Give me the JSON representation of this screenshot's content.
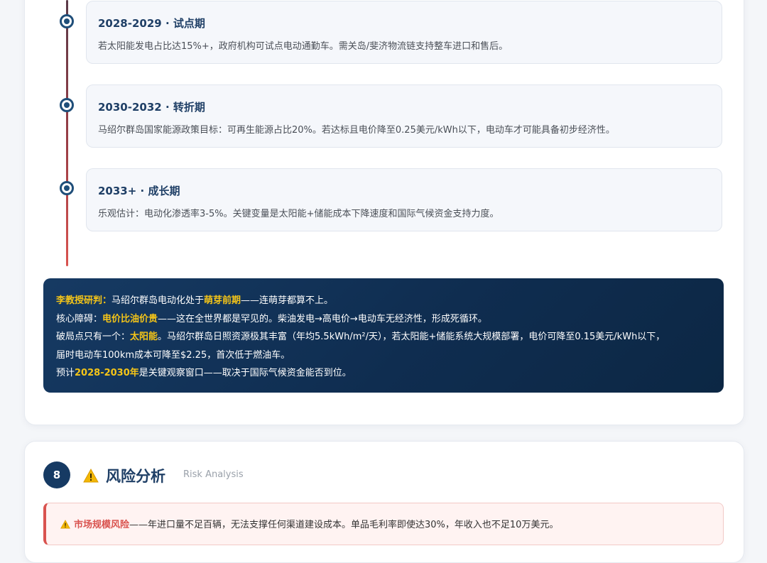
{
  "timeline": [
    {
      "title": "2028-2029 · 试点期",
      "desc": "若太阳能发电占比达15%+，政府机构可试点电动通勤车。需关岛/斐济物流链支持整车进口和售后。"
    },
    {
      "title": "2030-2032 · 转折期",
      "desc": "马绍尔群岛国家能源政策目标：可再生能源占比20%。若达标且电价降至0.25美元/kWh以下，电动车才可能具备初步经济性。"
    },
    {
      "title": "2033+ · 成长期",
      "desc": "乐观估计：电动化渗透率3-5%。关键变量是太阳能+储能成本下降速度和国际气候资金支持力度。"
    }
  ],
  "verdict": {
    "line1_label": "李教授研判：",
    "line1_pre": "马绍尔群岛电动化处于",
    "line1_hl": "萌芽前期",
    "line1_post": "——连萌芽都算不上。",
    "line2_pre": "核心障碍：",
    "line2_hl": "电价比油价贵",
    "line2_post": "——这在全世界都是罕见的。柴油发电→高电价→电动车无经济性，形成死循环。",
    "line3_pre": "破局点只有一个：",
    "line3_hl": "太阳能",
    "line3_post": "。马绍尔群岛日照资源极其丰富（年均5.5kWh/m²/天），若太阳能+储能系统大规模部署，电价可降至0.15美元/kWh以下，",
    "line4": "届时电动车100km成本可降至$2.25，首次低于燃油车。",
    "line5_pre": "预计",
    "line5_hl": "2028-2030年",
    "line5_post": "是关键观察窗口——取决于国际气候资金能否到位。"
  },
  "section": {
    "number": "8",
    "icon": "warning-icon",
    "title": "风险分析",
    "subtitle": "Risk Analysis"
  },
  "risks": [
    {
      "icon": "warning-icon",
      "name": "市场规模风险",
      "text": "——年进口量不足百辆，无法支撑任何渠道建设成本。单品毛利率即使达30%，年收入也不足10万美元。"
    }
  ],
  "colors": {
    "accent": "#1f3f66",
    "highlight": "#f5c518",
    "risk": "#d9534f"
  }
}
